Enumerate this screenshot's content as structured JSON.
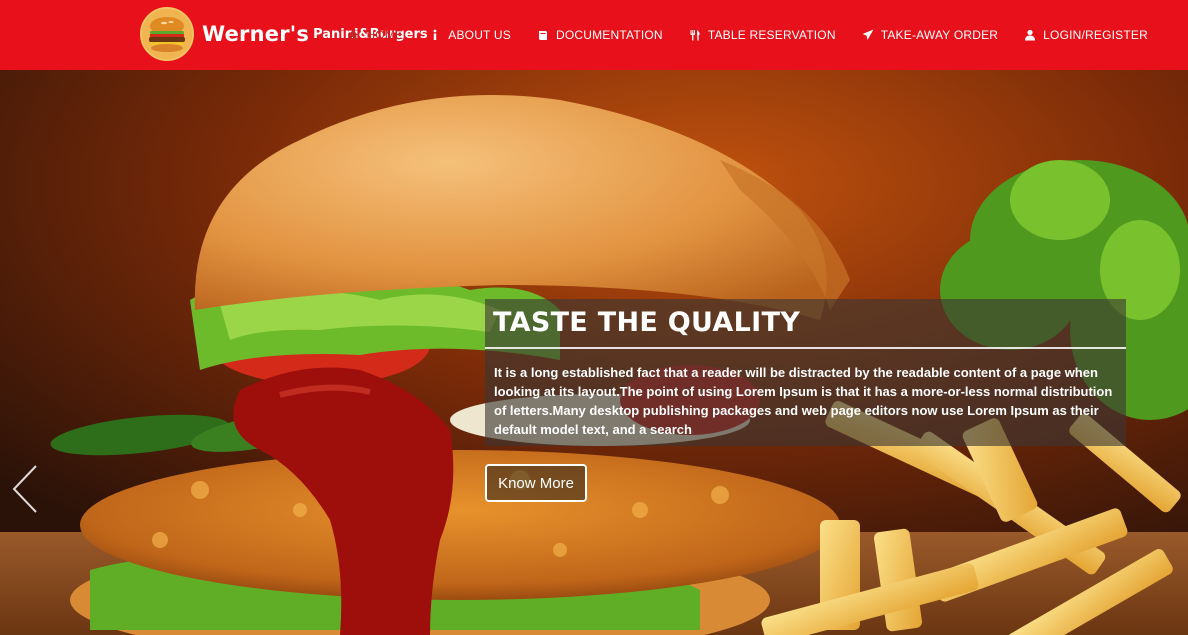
{
  "brand": {
    "name": "Werner's",
    "subtitle": "Panini&Burgers",
    "logo_icon": "burger-logo-icon"
  },
  "nav": {
    "items": [
      {
        "label": "HOME",
        "icon": "home-icon",
        "active": true
      },
      {
        "label": "ABOUT US",
        "icon": "info-icon"
      },
      {
        "label": "DOCUMENTATION",
        "icon": "book-icon"
      },
      {
        "label": "TABLE RESERVATION",
        "icon": "cutlery-icon"
      },
      {
        "label": "TAKE-AWAY ORDER",
        "icon": "paper-plane-icon"
      },
      {
        "label": "LOGIN/REGISTER",
        "icon": "user-icon"
      }
    ]
  },
  "hero": {
    "title": "TASTE THE QUALITY",
    "text": "It is a long established fact that a reader will be distracted by the readable content of a page when looking at its layout.The point of using Lorem Ipsum is that it has a more-or-less normal distribution of letters.Many desktop publishing packages and web page editors now use Lorem Ipsum as their default model text, and a search",
    "button_label": "Know More",
    "prev_icon": "chevron-left-icon"
  },
  "colors": {
    "header_bg": "#e8101a",
    "active_nav": "#c0262a",
    "caption_bg": "rgba(60,55,50,0.62)"
  }
}
